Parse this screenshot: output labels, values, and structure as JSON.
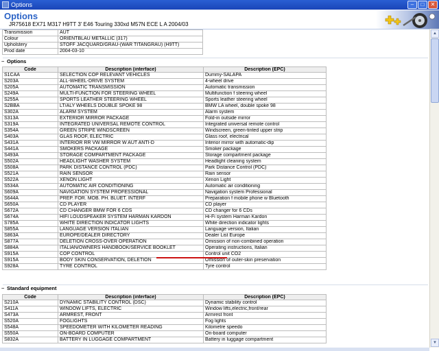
{
  "window": {
    "title": "Options"
  },
  "header": {
    "title": "Options",
    "vehicle": "JR75618 EX71 M317 H9TT 3' E46 Touring 330xd M57N ECE L A 2004/03"
  },
  "info": [
    {
      "key": "Transmission",
      "value": "AUT"
    },
    {
      "key": "Colour",
      "value": "ORIENTBLAU METALLIC (317)"
    },
    {
      "key": "Upholstery",
      "value": "STOFF JACQUARD/GRAU-(WAR TITANGRAU) (H9TT)"
    },
    {
      "key": "Prod date",
      "value": "2004-03-10"
    }
  ],
  "options": {
    "title": "Options",
    "headers": {
      "code": "Code",
      "interface": "Description (interface)",
      "epc": "Description (EPC)"
    },
    "rows": [
      {
        "code": "S1CAA",
        "interface": "SELECTION COP RELEVANT VEHICLES",
        "epc": "Dummy-SALAPA"
      },
      {
        "code": "S203A",
        "interface": "ALL-WHEEL-DRIVE SYSTEM",
        "epc": "4-wheel drive"
      },
      {
        "code": "S205A",
        "interface": "AUTOMATIC TRANSMISSION",
        "epc": "Automatic transmission"
      },
      {
        "code": "S249A",
        "interface": "MULTI-FUNCTION FOR STEERING WHEEL",
        "epc": "Multifunction f steering wheel"
      },
      {
        "code": "S255A",
        "interface": "SPORTS LEATHER STEERING WHEEL",
        "epc": "Sports leather steering wheel"
      },
      {
        "code": "S2BBA",
        "interface": "LT/ALY WHEELS DOUBLE SPOKE 98",
        "epc": "BMW LA wheel, double spoke 98"
      },
      {
        "code": "S302A",
        "interface": "ALARM SYSTEM",
        "epc": "Alarm system"
      },
      {
        "code": "S313A",
        "interface": "EXTERIOR MIRROR PACKAGE",
        "epc": "Fold-in outside mirror"
      },
      {
        "code": "S319A",
        "interface": "INTEGRATED UNIVERSAL REMOTE CONTROL",
        "epc": "Integrated universal remote control"
      },
      {
        "code": "S354A",
        "interface": "GREEN STRIPE WINDSCREEN",
        "epc": "Windscreen, green-tinted upper strip"
      },
      {
        "code": "S403A",
        "interface": "GLAS ROOF, ELECTRIC",
        "epc": "Glass roof, electrical"
      },
      {
        "code": "S431A",
        "interface": "INTERIOR RR VW MIRROR W AUT ANTI-D",
        "epc": "Interior mirror with automatic-dip"
      },
      {
        "code": "S441A",
        "interface": "SMOKERS PACKAGE",
        "epc": "Smoker package"
      },
      {
        "code": "S493A",
        "interface": "STORAGE COMPARTMENT PACKAGE",
        "epc": "Storage compartment package"
      },
      {
        "code": "S502A",
        "interface": "HEADLIGHT WASHER SYSTEM",
        "epc": "Headlight cleaning system"
      },
      {
        "code": "S508A",
        "interface": "PARK DISTANCE CONTROL (PDC)",
        "epc": "Park Distance Control (PDC)"
      },
      {
        "code": "S521A",
        "interface": "RAIN SENSOR",
        "epc": "Rain sensor"
      },
      {
        "code": "S522A",
        "interface": "XENON LIGHT",
        "epc": "Xenon Light"
      },
      {
        "code": "S534A",
        "interface": "AUTOMATIC AIR CONDITIONING",
        "epc": "Automatic air conditioning"
      },
      {
        "code": "S609A",
        "interface": "NAVIGATION SYSTEM PROFESSIONAL",
        "epc": "Navigation system Professional"
      },
      {
        "code": "S644A",
        "interface": "PREP. FOR. MOB. PH. BLUET. INTERF",
        "epc": "Preparation f mobile phone w Bluetooth"
      },
      {
        "code": "S650A",
        "interface": "CD PLAYER",
        "epc": "CD player"
      },
      {
        "code": "S672A",
        "interface": "CD CHANGER BMW FOR 6 CDS",
        "epc": "CD changer for 6 CDs"
      },
      {
        "code": "S674A",
        "interface": "HIFI LOUDSPEAKER SYSTEM HARMAN KARDON",
        "epc": "Hi-Fi system Harman Kardon"
      },
      {
        "code": "S785A",
        "interface": "WHITE DIRECTION INDICATOR LIGHTS",
        "epc": "White direction indicator lights"
      },
      {
        "code": "S855A",
        "interface": "LANGUAGE VERSION ITALIAN",
        "epc": "Language version, Italian"
      },
      {
        "code": "S863A",
        "interface": "EUROPE/DEALER DIRECTORY",
        "epc": "Dealer List Europe"
      },
      {
        "code": "S877A",
        "interface": "DELETION CROSS-OVER OPERATION",
        "epc": "Omission of non-combined operation"
      },
      {
        "code": "S884A",
        "interface": "ITALIAN/OWNERS HANDBOOK/SERVICE BOOKLET",
        "epc": "Operating instructions, Italian"
      },
      {
        "code": "S915A",
        "interface": "COP CONTROL",
        "epc": "Control unit CO2"
      },
      {
        "code": "S915A",
        "interface": "BODY SKIN CONSERVATION, DELETION",
        "epc": "Omission of outer-skin preservation"
      },
      {
        "code": "S928A",
        "interface": "TYRE CONTROL",
        "epc": "Tyre control"
      }
    ]
  },
  "standard": {
    "title": "Standard equipment",
    "headers": {
      "code": "Code",
      "interface": "Description (interface)",
      "epc": "Description (EPC)"
    },
    "rows": [
      {
        "code": "S210A",
        "interface": "DYNAMIC STABILITY CONTROL (DSC)",
        "epc": "Dynamic stability control"
      },
      {
        "code": "S411A",
        "interface": "WINDOW LIFTS, ELECTRIC",
        "epc": "Window lifts,electric,front/rear"
      },
      {
        "code": "S473A",
        "interface": "ARMREST, FRONT",
        "epc": "Armrest front"
      },
      {
        "code": "S520A",
        "interface": "FOGLIGHTS",
        "epc": "Fog lights"
      },
      {
        "code": "S548A",
        "interface": "SPEEDOMETER WITH KILOMETER READING",
        "epc": "Kilometre speedo"
      },
      {
        "code": "S550A",
        "interface": "ON-BOARD COMPUTER",
        "epc": "On-board computer"
      },
      {
        "code": "S832A",
        "interface": "BATTERY IN LUGGAGE COMPARTMENT",
        "epc": "Battery in luggage compartment"
      }
    ]
  },
  "section_marker": "−",
  "colors": {
    "title_blue": "#2b63c6",
    "highlight": "#cc1111"
  }
}
